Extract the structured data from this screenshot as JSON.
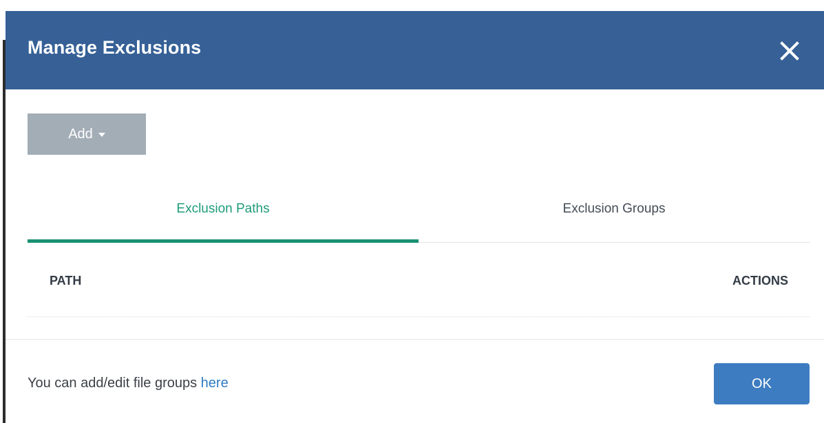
{
  "dialog": {
    "title": "Manage Exclusions",
    "close_icon": "close-icon"
  },
  "toolbar": {
    "add_label": "Add",
    "add_caret_icon": "caret-down-icon"
  },
  "tabs": [
    {
      "label": "Exclusion Paths",
      "active": true
    },
    {
      "label": "Exclusion Groups",
      "active": false
    }
  ],
  "table": {
    "columns": [
      "PATH",
      "ACTIONS"
    ],
    "rows": []
  },
  "footer": {
    "text": "You can add/edit file groups ",
    "link_label": "here",
    "ok_label": "OK"
  },
  "colors": {
    "header_bg": "#366096",
    "active_tab": "#199173",
    "ok_button": "#3d7cc1",
    "add_button": "#a3adb6",
    "link": "#2f7bc4"
  }
}
